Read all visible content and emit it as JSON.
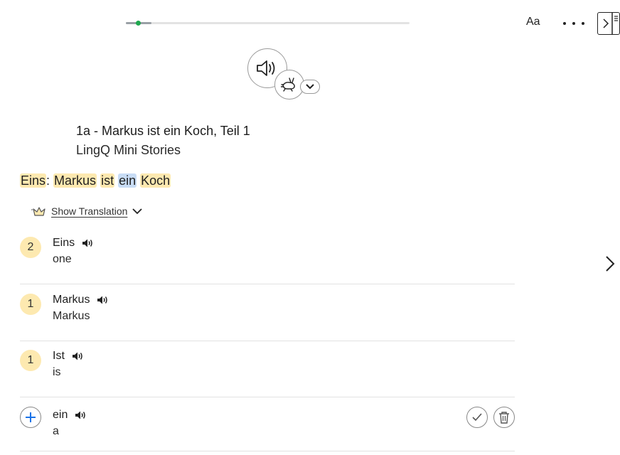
{
  "toolbar": {
    "font_label": "Aa",
    "progress_fraction": 0.09,
    "progress_marker_fraction": 0.035
  },
  "lesson": {
    "title": "1a - Markus ist ein Koch, Teil 1",
    "course": "LingQ Mini Stories"
  },
  "sentence": {
    "words": [
      "Eins",
      "Markus",
      "ist",
      "ein",
      "Koch"
    ],
    "punctuation": ":"
  },
  "translation_toggle": {
    "label": "Show Translation"
  },
  "word_list": [
    {
      "term": "Eins",
      "meaning": "one",
      "status": "2"
    },
    {
      "term": "Markus",
      "meaning": "Markus",
      "status": "1"
    },
    {
      "term": "Ist",
      "meaning": "is",
      "status": "1"
    },
    {
      "term": "ein",
      "meaning": "a",
      "status": ""
    }
  ],
  "icons": {
    "audio": "speaker-icon",
    "speed": "hare-icon",
    "more": "more-dots-icon",
    "sidebar": "sidebar-toggle-icon",
    "next": "chevron-right-icon",
    "add": "plus-icon",
    "known": "check-icon",
    "delete": "trash-icon",
    "crown": "crown-icon"
  },
  "colors": {
    "highlight_yellow": "#fde9b0",
    "highlight_blue": "#c8dcf5",
    "progress_green": "#1fa84f",
    "add_blue": "#1a73e8"
  }
}
